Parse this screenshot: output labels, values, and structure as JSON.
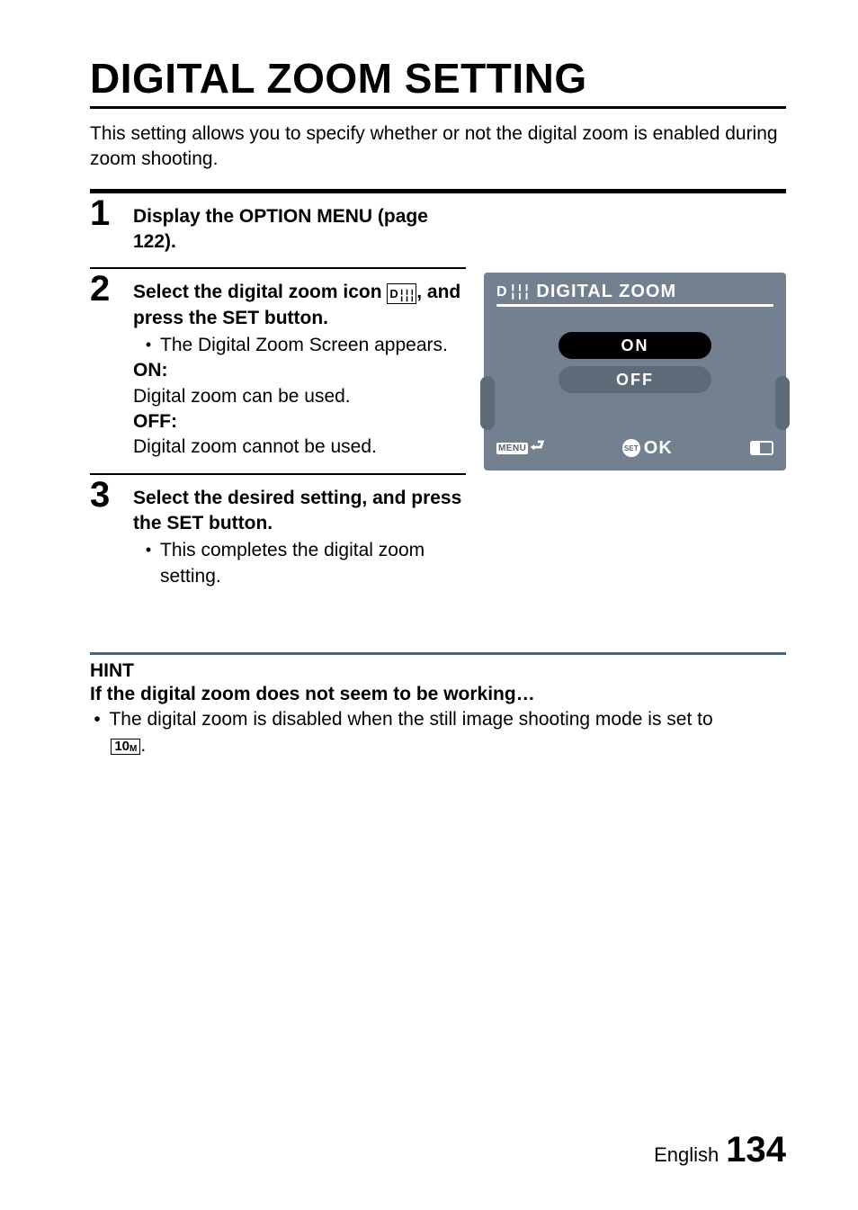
{
  "title": "DIGITAL ZOOM SETTING",
  "intro": "This setting allows you to specify whether or not the digital zoom is enabled during zoom shooting.",
  "steps": {
    "s1": {
      "num": "1",
      "text": "Display the OPTION MENU (page 122)."
    },
    "s2": {
      "num": "2",
      "lead_a": "Select the digital zoom icon ",
      "lead_b": ", and press the SET button.",
      "bullet": "The Digital Zoom Screen appears.",
      "on_label": "ON:",
      "on_text": "Digital zoom can be used.",
      "off_label": "OFF:",
      "off_text": "Digital zoom cannot be used."
    },
    "s3": {
      "num": "3",
      "lead": "Select the desired setting, and press the SET button.",
      "bullet": "This completes the digital zoom setting."
    }
  },
  "screen": {
    "header_icon_d": "D",
    "header_icon_bars": "⬖⬖⬖",
    "header": "DIGITAL ZOOM",
    "on": "ON",
    "off": "OFF",
    "menu": "MENU",
    "set": "SET",
    "ok": "OK"
  },
  "hint": {
    "label": "HINT",
    "subhead": "If the digital zoom does not seem to be working…",
    "text_a": "The digital zoom is disabled when the still image shooting mode is set to ",
    "mode_icon": "10",
    "mode_icon_sub": "M",
    "text_b": "."
  },
  "footer": {
    "lang": "English",
    "page": "134"
  },
  "icon": {
    "d": "D",
    "bars": "╎╎╎"
  }
}
